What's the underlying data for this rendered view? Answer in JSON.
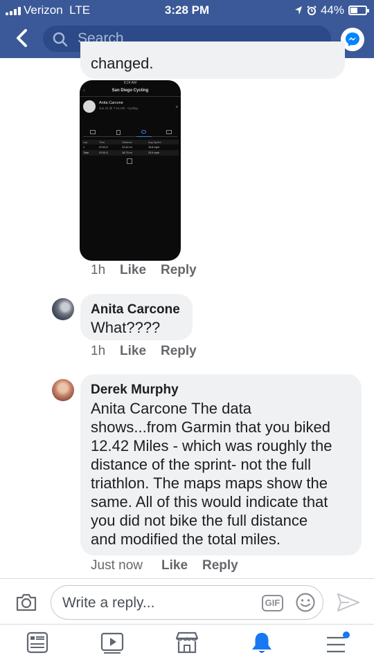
{
  "status_bar": {
    "carrier": "Verizon",
    "network": "LTE",
    "time": "3:28 PM",
    "battery": "44%"
  },
  "header": {
    "search_placeholder": "Search",
    "icons": [
      "back-chevron-icon",
      "search-icon",
      "messenger-icon"
    ]
  },
  "comments": [
    {
      "text_tail": "changed.",
      "attachment": {
        "status_time": "8:24 AM",
        "title": "San Diego Cycling",
        "user": "Anita Carcone",
        "subtitle": "Jun 24 @ 7:24 AM · Cycling",
        "columns": [
          "Lap",
          "Time",
          "Distance",
          "Avg Speed"
        ],
        "rows": [
          [
            "1",
            "47:00.3",
            "12.42 mi",
            "15.8 mph"
          ],
          [
            "Total",
            "47:00.3",
            "18.73 mi",
            "23.9 mph"
          ]
        ]
      },
      "time": "1h",
      "like_label": "Like",
      "reply_label": "Reply"
    },
    {
      "author": "Anita Carcone",
      "lines": [
        "What????"
      ],
      "time": "1h",
      "like_label": "Like",
      "reply_label": "Reply"
    },
    {
      "author": "Derek Murphy",
      "lines": [
        "Anita Carcone The data",
        "shows...from Garmin that you biked",
        "12.42 Miles - which was roughly the",
        "distance of the sprint- not the full",
        "triathlon. The maps maps show the",
        "same. All of this would indicate that",
        "you did not bike the full distance",
        "and modified the total miles."
      ],
      "time": "Just now",
      "like_label": "Like",
      "reply_label": "Reply"
    }
  ],
  "composer": {
    "placeholder": "Write a reply...",
    "gif_label": "GIF"
  },
  "tabs": [
    {
      "icon": "news-feed-icon",
      "active": false
    },
    {
      "icon": "watch-video-icon",
      "active": false
    },
    {
      "icon": "marketplace-icon",
      "active": false
    },
    {
      "icon": "notifications-bell-icon",
      "active": true
    },
    {
      "icon": "menu-icon",
      "active": false,
      "badge": true
    }
  ],
  "colors": {
    "brand_blue": "#3b5998",
    "active_tab": "#1877f2",
    "bubble_bg": "#f0f1f3"
  }
}
